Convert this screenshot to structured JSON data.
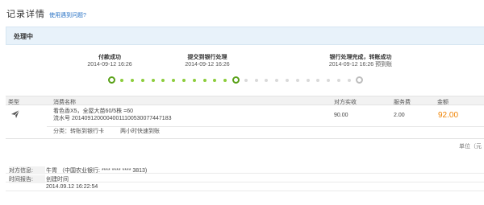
{
  "header": {
    "title": "记录详情",
    "help_link": "使用遇到问题?"
  },
  "status": {
    "text": "处理中"
  },
  "steps": [
    {
      "label": "付款成功",
      "time": "2014-09-12 16:26"
    },
    {
      "label": "提交到银行处理",
      "time": "2014-09-12 16:26"
    },
    {
      "label": "银行处理完成，转账成功",
      "time": "2014-09-12 16:26 预到账"
    }
  ],
  "progress": {
    "completed_steps": 2,
    "total_steps": 3
  },
  "table": {
    "headers": {
      "type": "类型",
      "name": "消费名称",
      "paid": "对方实收",
      "fee": "服务费",
      "amount": "金额"
    },
    "row": {
      "icon": "transfer-plane-icon",
      "name_line1": "看色香X5，全屋大苗60/5株 =60",
      "name_line2": "流水号 20140912000040011100530077447183",
      "paid": "90.00",
      "fee": "2.00",
      "amount": "92.00",
      "category": "分类：转账到银行卡",
      "speed": "两小时快速到账"
    }
  },
  "unit": "单位（元",
  "info": {
    "counterparty_label": "对方信息:",
    "counterparty_value": "牛胃 （中国农业银行: **** **** **** 3813)",
    "time_label": "时间报告:",
    "created_label": "创建时间",
    "created_value": "2014.09.12 16:22:54"
  },
  "colors": {
    "accent_green": "#59a118",
    "amount_orange": "#f08200",
    "link_blue": "#2a73c5"
  }
}
